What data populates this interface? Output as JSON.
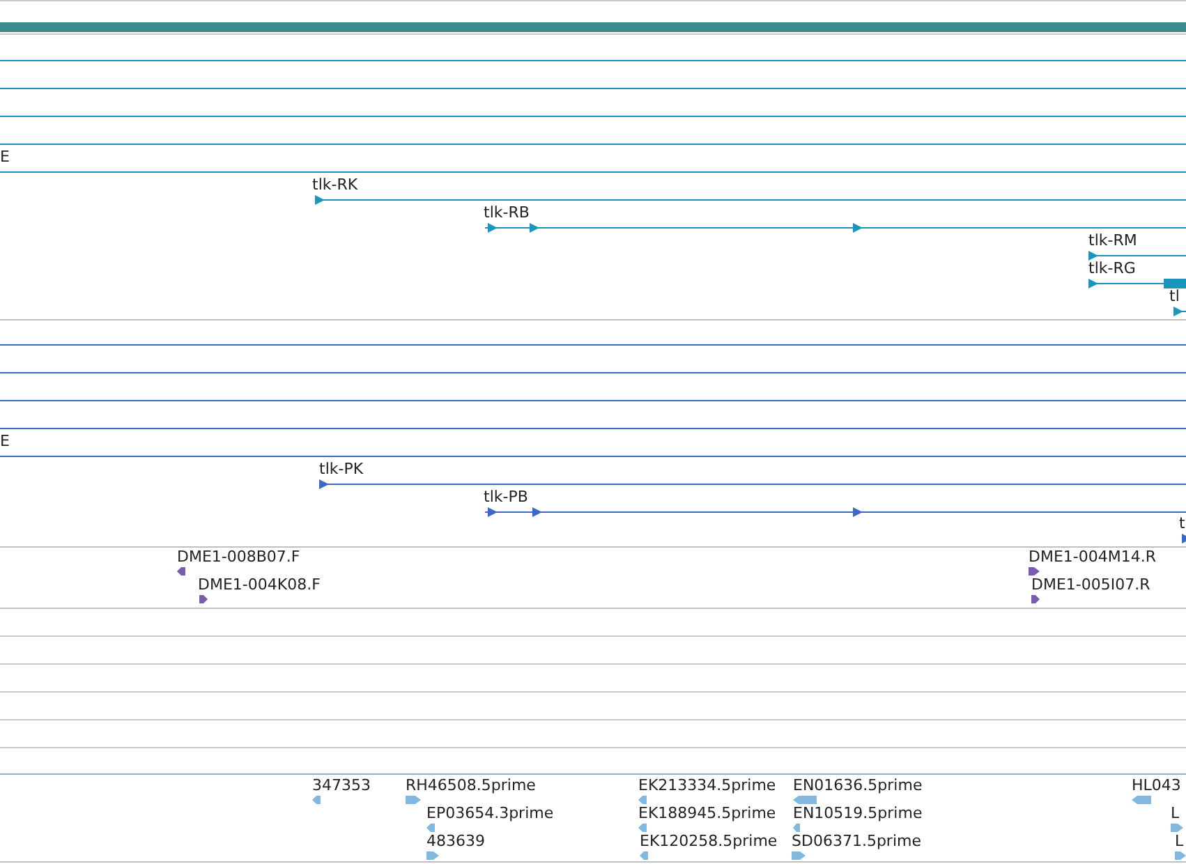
{
  "tracks": [
    {
      "kind": "transcripts",
      "color": "#1a96be",
      "features": [
        {
          "kind": "span"
        },
        {
          "kind": "span"
        },
        {
          "kind": "span"
        },
        {
          "kind": "span"
        },
        {
          "kind": "span",
          "label": "E"
        },
        {
          "kind": "gene",
          "label": "tlk-RK",
          "reverse": false
        },
        {
          "kind": "gene",
          "label": "tlk-RB",
          "reverse": false
        },
        {
          "kind": "gene",
          "label": "tlk-RM",
          "reverse": false
        },
        {
          "kind": "gene",
          "label": "tlk-RG",
          "reverse": false
        },
        {
          "kind": "gene",
          "label": "tl",
          "reverse": false
        }
      ]
    },
    {
      "kind": "proteins",
      "color": "#3a6ac8",
      "features": [
        {
          "kind": "span"
        },
        {
          "kind": "span"
        },
        {
          "kind": "span"
        },
        {
          "kind": "span"
        },
        {
          "kind": "span",
          "label": "E"
        },
        {
          "kind": "gene",
          "label": "tlk-PK",
          "reverse": false
        },
        {
          "kind": "gene",
          "label": "tlk-PB",
          "reverse": false
        },
        {
          "kind": "gene",
          "label": "t",
          "reverse": false
        }
      ]
    },
    {
      "kind": "bac_ends",
      "color": "#7a5cb0",
      "features": [
        {
          "kind": "read",
          "label": "DME1-008B07.F",
          "reverse": true
        },
        {
          "kind": "read",
          "label": "DME1-004K08.F",
          "reverse": false
        },
        {
          "kind": "read",
          "label": "DME1-004M14.R",
          "reverse": false
        },
        {
          "kind": "read",
          "label": "DME1-005I07.R",
          "reverse": false
        }
      ]
    },
    {
      "kind": "empty"
    },
    {
      "kind": "empty"
    },
    {
      "kind": "empty"
    },
    {
      "kind": "empty"
    },
    {
      "kind": "empty"
    },
    {
      "kind": "ests",
      "color": "#80b8e0",
      "features": [
        {
          "kind": "read",
          "label": "347353",
          "reverse": true
        },
        {
          "kind": "read",
          "label": "RH46508.5prime",
          "reverse": false
        },
        {
          "kind": "read",
          "label": "EP03654.3prime",
          "reverse": true
        },
        {
          "kind": "read",
          "label": "483639",
          "reverse": false
        },
        {
          "kind": "read",
          "label": "EK213334.5prime",
          "reverse": true
        },
        {
          "kind": "read",
          "label": "EK188945.5prime",
          "reverse": true
        },
        {
          "kind": "read",
          "label": "EK120258.5prime",
          "reverse": true
        },
        {
          "kind": "read",
          "label": "EN01636.5prime",
          "reverse": true
        },
        {
          "kind": "read",
          "label": "EN10519.5prime",
          "reverse": true
        },
        {
          "kind": "read",
          "label": "SD06371.5prime",
          "reverse": false
        },
        {
          "kind": "read",
          "label": "HL043",
          "reverse": true
        },
        {
          "kind": "read",
          "label": "L",
          "reverse": false
        },
        {
          "kind": "read",
          "label": "L",
          "reverse": false
        }
      ]
    }
  ]
}
